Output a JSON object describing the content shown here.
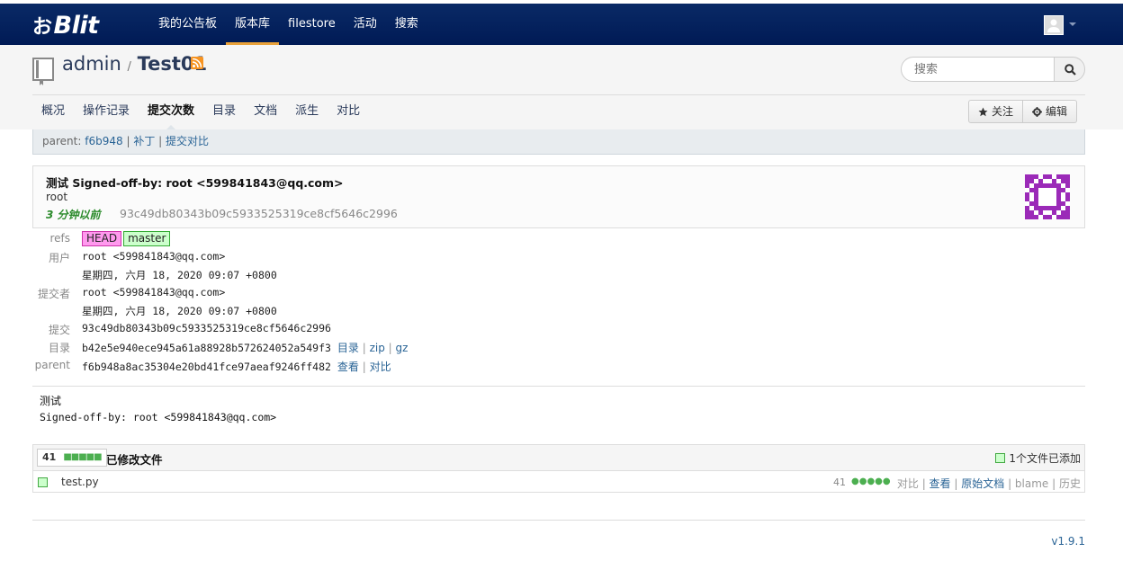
{
  "topnav": {
    "logo_mark": "お",
    "logo_text": "Blit",
    "links": [
      "我的公告板",
      "版本库",
      "filestore",
      "活动",
      "搜索"
    ],
    "active_link": "版本库"
  },
  "repo": {
    "owner": "admin",
    "separator": "/",
    "name": "Test01",
    "search_placeholder": "搜索",
    "tabs": [
      "概况",
      "操作记录",
      "提交次数",
      "目录",
      "文档",
      "派生",
      "对比"
    ],
    "active_tab": "提交次数",
    "watch_label": "关注",
    "edit_label": "编辑"
  },
  "parent_bar": {
    "label": "parent:",
    "sha": "f6b948",
    "sep1": "|",
    "patch": "补丁",
    "sep2": "|",
    "compare": "提交对比"
  },
  "commit": {
    "message": "测试 Signed-off-by: root <599841843@qq.com>",
    "author": "root",
    "when": "3 分钟以前",
    "sha": "93c49db80343b09c5933525319ce8cf5646c2996"
  },
  "details": {
    "refs_label": "refs",
    "refs": [
      "HEAD",
      "master"
    ],
    "author_label": "用户",
    "author": "root <599841843@qq.com>",
    "author_date": "星期四, 六月 18, 2020 09:07 +0800",
    "committer_label": "提交者",
    "committer": "root <599841843@qq.com>",
    "committer_date": "星期四, 六月 18, 2020 09:07 +0800",
    "commit_label": "提交",
    "commit_sha": "93c49db80343b09c5933525319ce8cf5646c2996",
    "tree_label": "目录",
    "tree_sha": "b42e5e940ece945a61a88928b572624052a549f3",
    "tree_links": [
      "目录",
      "zip",
      "gz"
    ],
    "parent_label": "parent",
    "parent_sha": "f6b948a8ac35304e20bd41fce97aeaf9246ff482",
    "parent_links": [
      "查看",
      "对比"
    ]
  },
  "full_message": {
    "line1": "测试",
    "line2": "Signed-off-by: root <599841843@qq.com>"
  },
  "files": {
    "count": "41",
    "blocks": "■■■■■",
    "title": "已修改文件",
    "summary": "1个文件已添加",
    "rows": [
      {
        "name": "test.py",
        "lines": "41",
        "dots": "●●●●●",
        "links": [
          "对比",
          "查看",
          "原始文档",
          "blame",
          "历史"
        ]
      }
    ]
  },
  "footer": {
    "version": "v1.9.1"
  },
  "colors": {
    "topbar": "#002060",
    "accent": "#e8a13a",
    "link": "#2a6496",
    "added": "#ccffcc",
    "identicon": "#9b2ab8"
  }
}
